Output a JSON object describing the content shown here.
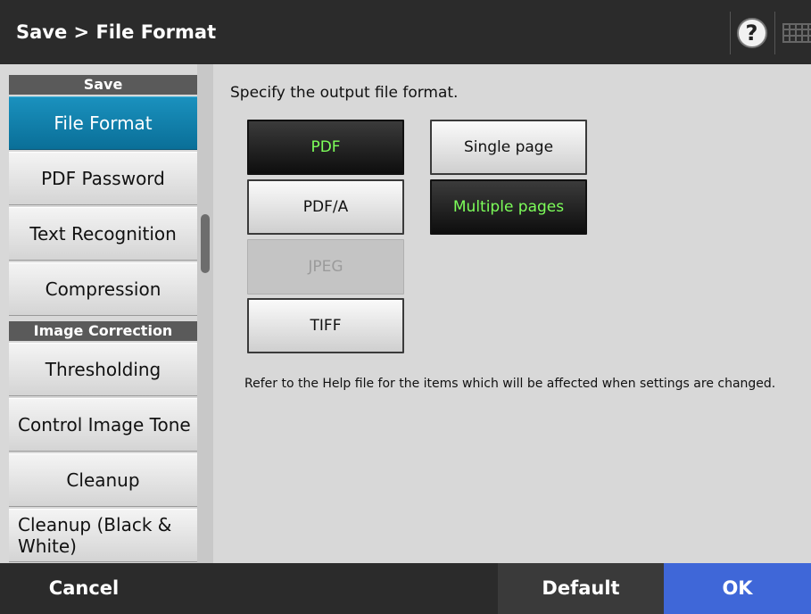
{
  "header": {
    "title": "Save > File Format",
    "help_glyph": "?",
    "help_icon": "help-icon",
    "keyboard_icon": "keyboard-icon"
  },
  "sidebar": {
    "sections": [
      {
        "header": "Save",
        "items": [
          {
            "label": "File Format",
            "active": true
          },
          {
            "label": "PDF Password",
            "active": false
          },
          {
            "label": "Text Recognition",
            "active": false
          },
          {
            "label": "Compression",
            "active": false
          }
        ]
      },
      {
        "header": "Image Correction",
        "items": [
          {
            "label": "Thresholding",
            "active": false
          },
          {
            "label": "Control Image Tone",
            "active": false
          },
          {
            "label": "Cleanup",
            "active": false
          },
          {
            "label": "Cleanup (Black & White)",
            "active": false
          }
        ]
      }
    ]
  },
  "main": {
    "instruction": "Specify the output file format.",
    "formats": [
      {
        "label": "PDF",
        "state": "selected"
      },
      {
        "label": "PDF/A",
        "state": "normal"
      },
      {
        "label": "JPEG",
        "state": "disabled"
      },
      {
        "label": "TIFF",
        "state": "normal"
      }
    ],
    "page_options": [
      {
        "label": "Single page",
        "state": "normal"
      },
      {
        "label": "Multiple pages",
        "state": "selected"
      }
    ],
    "note": "Refer to the Help file for the items which will be affected when settings are changed."
  },
  "footer": {
    "cancel_label": "Cancel",
    "default_label": "Default",
    "ok_label": "OK"
  },
  "colors": {
    "bar_background": "#2b2b2b",
    "active_item": "#0a6f98",
    "selected_text": "#7dff5a",
    "ok_button": "#3f67d8"
  }
}
